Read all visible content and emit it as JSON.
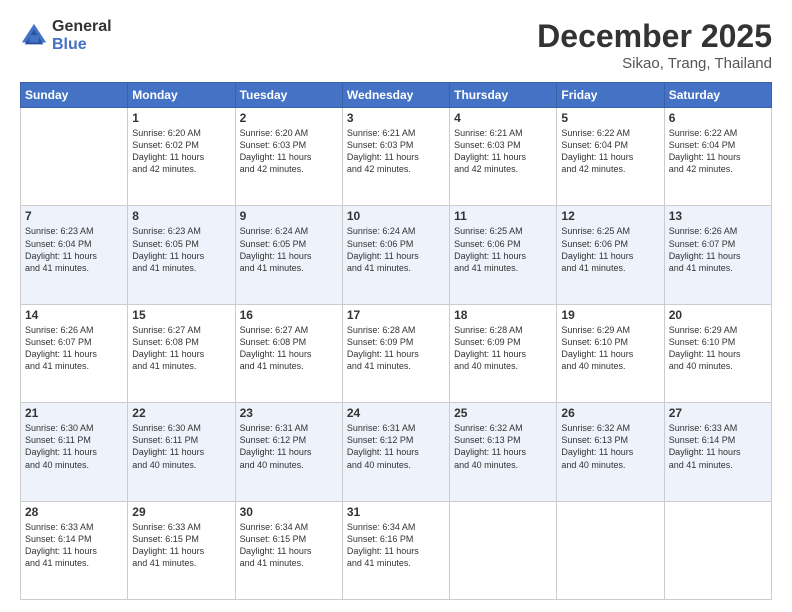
{
  "header": {
    "logo_general": "General",
    "logo_blue": "Blue",
    "main_title": "December 2025",
    "subtitle": "Sikao, Trang, Thailand"
  },
  "days_of_week": [
    "Sunday",
    "Monday",
    "Tuesday",
    "Wednesday",
    "Thursday",
    "Friday",
    "Saturday"
  ],
  "weeks": [
    [
      {
        "day": "",
        "info": ""
      },
      {
        "day": "1",
        "info": "Sunrise: 6:20 AM\nSunset: 6:02 PM\nDaylight: 11 hours\nand 42 minutes."
      },
      {
        "day": "2",
        "info": "Sunrise: 6:20 AM\nSunset: 6:03 PM\nDaylight: 11 hours\nand 42 minutes."
      },
      {
        "day": "3",
        "info": "Sunrise: 6:21 AM\nSunset: 6:03 PM\nDaylight: 11 hours\nand 42 minutes."
      },
      {
        "day": "4",
        "info": "Sunrise: 6:21 AM\nSunset: 6:03 PM\nDaylight: 11 hours\nand 42 minutes."
      },
      {
        "day": "5",
        "info": "Sunrise: 6:22 AM\nSunset: 6:04 PM\nDaylight: 11 hours\nand 42 minutes."
      },
      {
        "day": "6",
        "info": "Sunrise: 6:22 AM\nSunset: 6:04 PM\nDaylight: 11 hours\nand 42 minutes."
      }
    ],
    [
      {
        "day": "7",
        "info": "Sunrise: 6:23 AM\nSunset: 6:04 PM\nDaylight: 11 hours\nand 41 minutes."
      },
      {
        "day": "8",
        "info": "Sunrise: 6:23 AM\nSunset: 6:05 PM\nDaylight: 11 hours\nand 41 minutes."
      },
      {
        "day": "9",
        "info": "Sunrise: 6:24 AM\nSunset: 6:05 PM\nDaylight: 11 hours\nand 41 minutes."
      },
      {
        "day": "10",
        "info": "Sunrise: 6:24 AM\nSunset: 6:06 PM\nDaylight: 11 hours\nand 41 minutes."
      },
      {
        "day": "11",
        "info": "Sunrise: 6:25 AM\nSunset: 6:06 PM\nDaylight: 11 hours\nand 41 minutes."
      },
      {
        "day": "12",
        "info": "Sunrise: 6:25 AM\nSunset: 6:06 PM\nDaylight: 11 hours\nand 41 minutes."
      },
      {
        "day": "13",
        "info": "Sunrise: 6:26 AM\nSunset: 6:07 PM\nDaylight: 11 hours\nand 41 minutes."
      }
    ],
    [
      {
        "day": "14",
        "info": "Sunrise: 6:26 AM\nSunset: 6:07 PM\nDaylight: 11 hours\nand 41 minutes."
      },
      {
        "day": "15",
        "info": "Sunrise: 6:27 AM\nSunset: 6:08 PM\nDaylight: 11 hours\nand 41 minutes."
      },
      {
        "day": "16",
        "info": "Sunrise: 6:27 AM\nSunset: 6:08 PM\nDaylight: 11 hours\nand 41 minutes."
      },
      {
        "day": "17",
        "info": "Sunrise: 6:28 AM\nSunset: 6:09 PM\nDaylight: 11 hours\nand 41 minutes."
      },
      {
        "day": "18",
        "info": "Sunrise: 6:28 AM\nSunset: 6:09 PM\nDaylight: 11 hours\nand 40 minutes."
      },
      {
        "day": "19",
        "info": "Sunrise: 6:29 AM\nSunset: 6:10 PM\nDaylight: 11 hours\nand 40 minutes."
      },
      {
        "day": "20",
        "info": "Sunrise: 6:29 AM\nSunset: 6:10 PM\nDaylight: 11 hours\nand 40 minutes."
      }
    ],
    [
      {
        "day": "21",
        "info": "Sunrise: 6:30 AM\nSunset: 6:11 PM\nDaylight: 11 hours\nand 40 minutes."
      },
      {
        "day": "22",
        "info": "Sunrise: 6:30 AM\nSunset: 6:11 PM\nDaylight: 11 hours\nand 40 minutes."
      },
      {
        "day": "23",
        "info": "Sunrise: 6:31 AM\nSunset: 6:12 PM\nDaylight: 11 hours\nand 40 minutes."
      },
      {
        "day": "24",
        "info": "Sunrise: 6:31 AM\nSunset: 6:12 PM\nDaylight: 11 hours\nand 40 minutes."
      },
      {
        "day": "25",
        "info": "Sunrise: 6:32 AM\nSunset: 6:13 PM\nDaylight: 11 hours\nand 40 minutes."
      },
      {
        "day": "26",
        "info": "Sunrise: 6:32 AM\nSunset: 6:13 PM\nDaylight: 11 hours\nand 40 minutes."
      },
      {
        "day": "27",
        "info": "Sunrise: 6:33 AM\nSunset: 6:14 PM\nDaylight: 11 hours\nand 41 minutes."
      }
    ],
    [
      {
        "day": "28",
        "info": "Sunrise: 6:33 AM\nSunset: 6:14 PM\nDaylight: 11 hours\nand 41 minutes."
      },
      {
        "day": "29",
        "info": "Sunrise: 6:33 AM\nSunset: 6:15 PM\nDaylight: 11 hours\nand 41 minutes."
      },
      {
        "day": "30",
        "info": "Sunrise: 6:34 AM\nSunset: 6:15 PM\nDaylight: 11 hours\nand 41 minutes."
      },
      {
        "day": "31",
        "info": "Sunrise: 6:34 AM\nSunset: 6:16 PM\nDaylight: 11 hours\nand 41 minutes."
      },
      {
        "day": "",
        "info": ""
      },
      {
        "day": "",
        "info": ""
      },
      {
        "day": "",
        "info": ""
      }
    ]
  ]
}
